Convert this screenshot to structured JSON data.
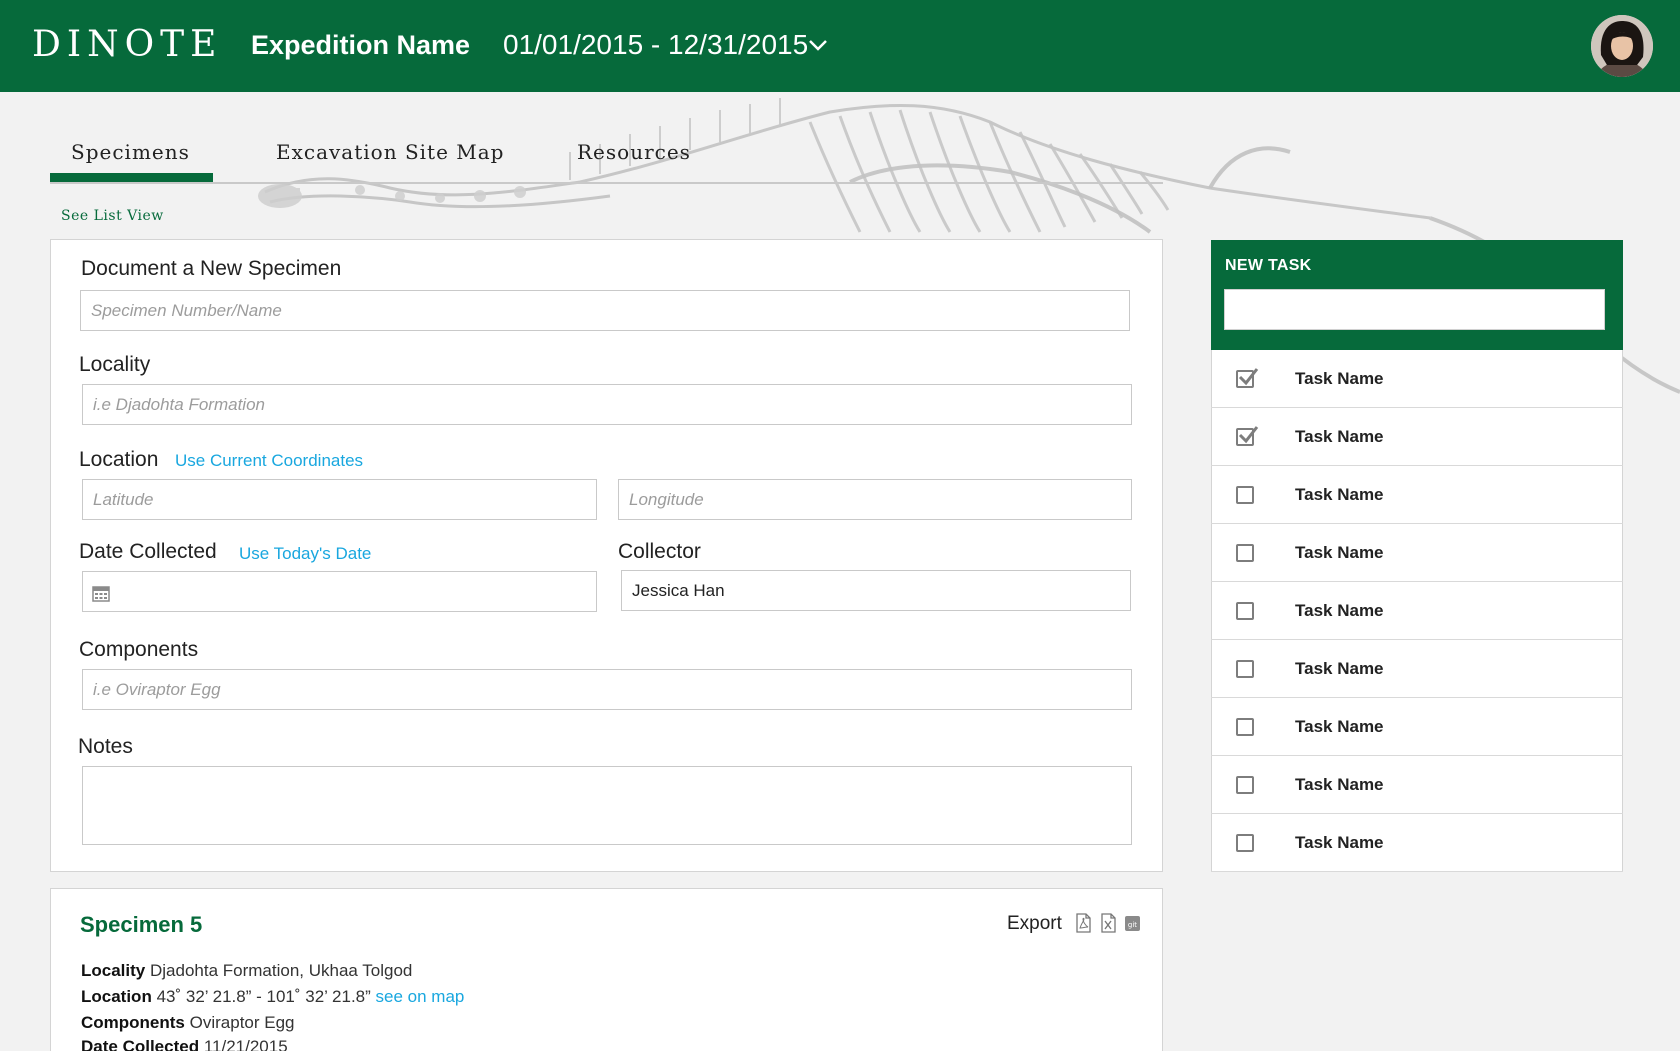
{
  "header": {
    "logo": "DINOTE",
    "expedition_name": "Expedition Name",
    "date_range": "01/01/2015 - 12/31/2015"
  },
  "tabs": [
    {
      "label": "Specimens",
      "active": true
    },
    {
      "label": "Excavation Site Map",
      "active": false
    },
    {
      "label": "Resources",
      "active": false
    }
  ],
  "see_list_view": "See List View",
  "form": {
    "title": "Document a New Specimen",
    "specimen_placeholder": "Specimen Number/Name",
    "locality_label": "Locality",
    "locality_placeholder": "i.e Djadohta Formation",
    "location_label": "Location",
    "use_coords": "Use Current Coordinates",
    "latitude_placeholder": "Latitude",
    "longitude_placeholder": "Longitude",
    "date_label": "Date Collected",
    "use_today": "Use Today's Date",
    "date_value": "",
    "collector_label": "Collector",
    "collector_value": "Jessica Han",
    "components_label": "Components",
    "components_placeholder": "i.e Oviraptor Egg",
    "notes_label": "Notes",
    "notes_value": ""
  },
  "specimen": {
    "title": "Specimen 5",
    "export_label": "Export",
    "export_icons": [
      "pdf-icon",
      "excel-icon",
      "git-icon"
    ],
    "locality_label": "Locality",
    "locality_value": "Djadohta Formation, Ukhaa Tolgod",
    "location_label": "Location",
    "location_value": "43˚ 32’ 21.8” -  101˚ 32’ 21.8”",
    "see_on_map": "see on map",
    "components_label": "Components",
    "components_value": "Oviraptor Egg",
    "date_label": "Date Collected",
    "date_value": "11/21/2015"
  },
  "tasks": {
    "header": "NEW TASK",
    "input_value": "",
    "items": [
      {
        "name": "Task Name",
        "done": true
      },
      {
        "name": "Task Name",
        "done": true
      },
      {
        "name": "Task Name",
        "done": false
      },
      {
        "name": "Task Name",
        "done": false
      },
      {
        "name": "Task Name",
        "done": false
      },
      {
        "name": "Task Name",
        "done": false
      },
      {
        "name": "Task Name",
        "done": false
      },
      {
        "name": "Task Name",
        "done": false
      },
      {
        "name": "Task Name",
        "done": false
      }
    ]
  },
  "colors": {
    "brand_green": "#066a3b",
    "link_blue": "#19a7df",
    "background": "#f2f2f2"
  }
}
